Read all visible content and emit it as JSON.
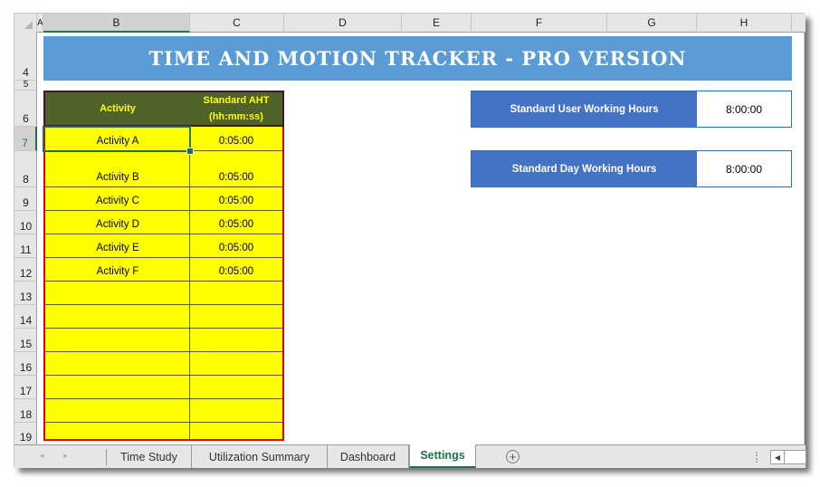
{
  "columns": [
    "A",
    "B",
    "C",
    "D",
    "E",
    "F",
    "G",
    "H"
  ],
  "selected_column": "B",
  "rows": [
    "4",
    "5",
    "6",
    "7",
    "8",
    "9",
    "10",
    "11",
    "12",
    "13",
    "14",
    "15",
    "16",
    "17",
    "18",
    "19"
  ],
  "selected_row": "7",
  "banner": {
    "title": "Time and Motion Tracker - Pro Version"
  },
  "activity_table": {
    "headers": {
      "activity": "Activity",
      "aht_line1": "Standard AHT",
      "aht_line2": "(hh:mm:ss)"
    },
    "rows": [
      {
        "activity": "Activity A",
        "aht": "0:05:00"
      },
      {
        "activity": "Activity B",
        "aht": "0:05:00"
      },
      {
        "activity": "Activity C",
        "aht": "0:05:00"
      },
      {
        "activity": "Activity D",
        "aht": "0:05:00"
      },
      {
        "activity": "Activity E",
        "aht": "0:05:00"
      },
      {
        "activity": "Activity F",
        "aht": "0:05:00"
      },
      {
        "activity": "",
        "aht": ""
      },
      {
        "activity": "",
        "aht": ""
      },
      {
        "activity": "",
        "aht": ""
      },
      {
        "activity": "",
        "aht": ""
      },
      {
        "activity": "",
        "aht": ""
      },
      {
        "activity": "",
        "aht": ""
      },
      {
        "activity": "",
        "aht": ""
      }
    ]
  },
  "settings": {
    "user_hours": {
      "label": "Standard User Working Hours",
      "value": "8:00:00"
    },
    "day_hours": {
      "label": "Standard Day Working Hours",
      "value": "8:00:00"
    }
  },
  "sheet_tabs": [
    {
      "label": "Time Study",
      "active": false
    },
    {
      "label": "Utilization Summary",
      "active": false
    },
    {
      "label": "Dashboard",
      "active": false
    },
    {
      "label": "Settings",
      "active": true
    }
  ],
  "icons": {
    "prev_sheet": "◂",
    "next_sheet": "▸",
    "add_sheet": "+",
    "scroll_left": "◀"
  },
  "colors": {
    "banner": "#5b9bd5",
    "table_header": "#4f6228",
    "table_fill": "#ffff00",
    "table_border": "#e0000b",
    "settings_label": "#4472c4",
    "excel_green": "#217346"
  }
}
